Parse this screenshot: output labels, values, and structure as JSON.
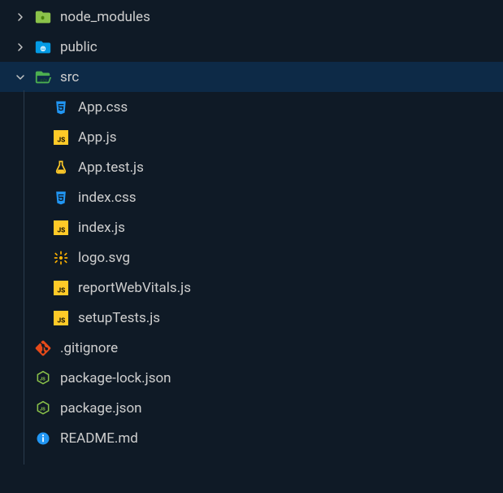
{
  "tree": {
    "items": [
      {
        "name": "node_modules",
        "type": "folder",
        "expanded": false,
        "level": 1,
        "icon": "folder-node",
        "selected": false
      },
      {
        "name": "public",
        "type": "folder",
        "expanded": false,
        "level": 1,
        "icon": "folder-public",
        "selected": false
      },
      {
        "name": "src",
        "type": "folder",
        "expanded": true,
        "level": 1,
        "icon": "folder-src",
        "selected": true
      },
      {
        "name": "App.css",
        "type": "file",
        "level": 2,
        "icon": "css",
        "selected": false
      },
      {
        "name": "App.js",
        "type": "file",
        "level": 2,
        "icon": "js",
        "selected": false
      },
      {
        "name": "App.test.js",
        "type": "file",
        "level": 2,
        "icon": "test",
        "selected": false
      },
      {
        "name": "index.css",
        "type": "file",
        "level": 2,
        "icon": "css",
        "selected": false
      },
      {
        "name": "index.js",
        "type": "file",
        "level": 2,
        "icon": "js",
        "selected": false
      },
      {
        "name": "logo.svg",
        "type": "file",
        "level": 2,
        "icon": "svg",
        "selected": false
      },
      {
        "name": "reportWebVitals.js",
        "type": "file",
        "level": 2,
        "icon": "js",
        "selected": false
      },
      {
        "name": "setupTests.js",
        "type": "file",
        "level": 2,
        "icon": "js",
        "selected": false
      },
      {
        "name": ".gitignore",
        "type": "file",
        "level": 1,
        "icon": "git",
        "selected": false
      },
      {
        "name": "package-lock.json",
        "type": "file",
        "level": 1,
        "icon": "nodejs",
        "selected": false
      },
      {
        "name": "package.json",
        "type": "file",
        "level": 1,
        "icon": "nodejs",
        "selected": false
      },
      {
        "name": "README.md",
        "type": "file",
        "level": 1,
        "icon": "readme",
        "selected": false
      }
    ]
  }
}
